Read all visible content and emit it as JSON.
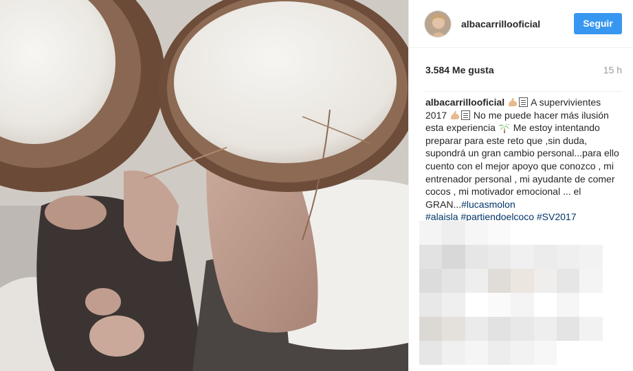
{
  "post": {
    "username": "albacarrillooficial",
    "follow_label": "Seguir",
    "likes": "3.584 Me gusta",
    "time": "15 h",
    "caption": {
      "user": "albacarrillooficial",
      "part1": " A supervivientes 2017 ",
      "part2": " No me puede hacer más ilusión esta experiencia ",
      "part3": " Me estoy intentando preparar para este reto que ,sin duda, supondrá un gran cambio personal...para ello cuento con el mejor apoyo que conozco , mi entrenador personal , mi ayudante de comer cocos , mi motivador emocional ... el GRAN...",
      "mention": "#lucasmolon",
      "hashtags": "#alaisla #partiendoelcoco #SV2017"
    }
  },
  "icons": {
    "muscle": "flexed-biceps-emoji-icon",
    "box": "unsupported-emoji-box-icon",
    "palm": "palm-tree-emoji-icon"
  },
  "colors": {
    "follow_button": "#3897f0",
    "hashtag": "#003569",
    "time": "#999999"
  }
}
